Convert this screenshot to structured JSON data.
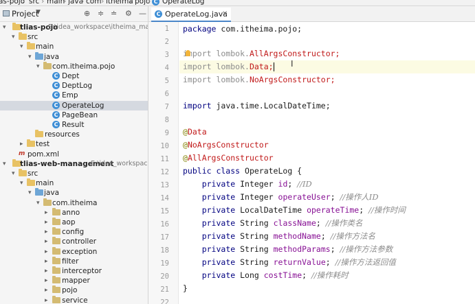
{
  "breadcrumb": {
    "items": [
      "as-pojo",
      "src",
      "main",
      "java",
      "com",
      "itheima",
      "pojo",
      "OperateLog"
    ]
  },
  "project_panel": {
    "title": "Project",
    "dropdown_icon": "chevron-down-icon",
    "header_icons": [
      "locate-icon",
      "expand-all-icon",
      "collapse-all-icon",
      "gear-icon",
      "minimize-icon"
    ]
  },
  "tree": [
    {
      "label": "tlias-pojo",
      "path": "E:\\idea_workspace\\itheima_maven_",
      "type": "module",
      "bold": true
    },
    {
      "label": "src",
      "type": "folder"
    },
    {
      "label": "main",
      "type": "folder"
    },
    {
      "label": "java",
      "type": "source-folder"
    },
    {
      "label": "com.itheima.pojo",
      "type": "package"
    },
    {
      "label": "Dept",
      "type": "class"
    },
    {
      "label": "DeptLog",
      "type": "class"
    },
    {
      "label": "Emp",
      "type": "class"
    },
    {
      "label": "OperateLog",
      "type": "class",
      "selected": true
    },
    {
      "label": "PageBean",
      "type": "class"
    },
    {
      "label": "Result",
      "type": "class"
    },
    {
      "label": "resources",
      "type": "folder"
    },
    {
      "label": "test",
      "type": "folder"
    },
    {
      "label": "pom.xml",
      "type": "maven"
    },
    {
      "label": "tlias-web-management",
      "path": "E:\\idea_workspace\\it",
      "type": "module",
      "bold": true
    },
    {
      "label": "src",
      "type": "folder"
    },
    {
      "label": "main",
      "type": "folder"
    },
    {
      "label": "java",
      "type": "source-folder"
    },
    {
      "label": "com.itheima",
      "type": "package"
    },
    {
      "label": "anno",
      "type": "package"
    },
    {
      "label": "aop",
      "type": "package"
    },
    {
      "label": "config",
      "type": "package"
    },
    {
      "label": "controller",
      "type": "package"
    },
    {
      "label": "exception",
      "type": "package"
    },
    {
      "label": "filter",
      "type": "package"
    },
    {
      "label": "interceptor",
      "type": "package"
    },
    {
      "label": "mapper",
      "type": "package"
    },
    {
      "label": "pojo",
      "type": "package"
    },
    {
      "label": "service",
      "type": "package"
    }
  ],
  "editor": {
    "tab_label": "OperateLog.java",
    "tab_close": "×",
    "line_numbers": [
      "1",
      "2",
      "3",
      "4",
      "5",
      "6",
      "7",
      "8",
      "9",
      "10",
      "11",
      "12",
      "13",
      "14",
      "15",
      "16",
      "17",
      "18",
      "19",
      "20",
      "21",
      "22"
    ],
    "code": {
      "l1_kw": "package",
      "l1_rest": " com.itheima.pojo;",
      "l3_a": "import lombok.",
      "l3_b": "AllArgsConstructor;",
      "l4_a": "import lombok.",
      "l4_b": "Data;",
      "l5_a": "import lombok.",
      "l5_b": "NoArgsConstructor;",
      "l7_kw": "import",
      "l7_rest": " java.time.LocalDateTime;",
      "l9_at": "@",
      "l9_name": "Data",
      "l10_at": "@",
      "l10_name": "NoArgsConstructor",
      "l11_at": "@",
      "l11_name": "AllArgsConstructor",
      "l12_kw": "public class",
      "l12_rest": " OperateLog {",
      "fields": [
        {
          "type": "Integer",
          "name": "id",
          "comment": "//ID"
        },
        {
          "type": "Integer",
          "name": "operateUser",
          "comment": "//操作人ID"
        },
        {
          "type": "LocalDateTime",
          "name": "operateTime",
          "comment": "//操作时间"
        },
        {
          "type": "String",
          "name": "className",
          "comment": "//操作类名"
        },
        {
          "type": "String",
          "name": "methodName",
          "comment": "//操作方法名"
        },
        {
          "type": "String",
          "name": "methodParams",
          "comment": "//操作方法参数"
        },
        {
          "type": "String",
          "name": "returnValue",
          "comment": "//操作方法返回值"
        },
        {
          "type": "Long",
          "name": "costTime",
          "comment": "//操作耗时"
        }
      ],
      "private_kw": "private",
      "l21": "}"
    }
  },
  "colors": {
    "keyword": "#000080",
    "annotation": "#808000",
    "field": "#871094",
    "comment": "#8c8c8c",
    "unresolved": "#c01818",
    "selection": "#d5d9e0"
  }
}
